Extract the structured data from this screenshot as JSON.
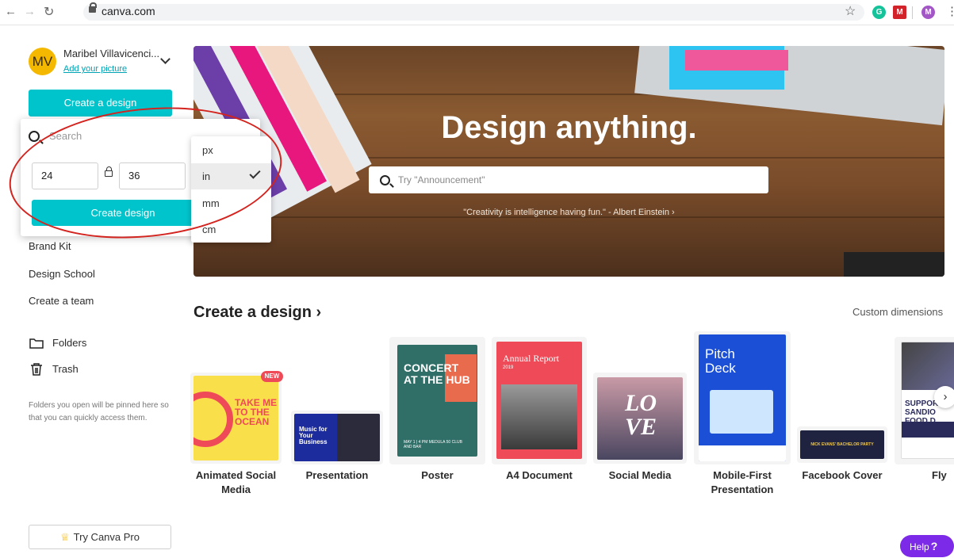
{
  "browser": {
    "url": "canva.com",
    "extensions": [
      {
        "name": "grammarly-icon",
        "letter": "G",
        "color": "#15c39a"
      },
      {
        "name": "mcafee-icon",
        "letter": "M",
        "color": "#d2232a"
      },
      {
        "name": "profile-icon",
        "letter": "M",
        "color": "#8e44ad"
      }
    ]
  },
  "sidebar": {
    "avatar_initials": "MV",
    "user_name": "Maribel Villavicenci...",
    "add_picture": "Add your picture",
    "create_design_button": "Create a design",
    "links": [
      "Brand Kit",
      "Design School",
      "Create a team"
    ],
    "folders": "Folders",
    "trash": "Trash",
    "note": "Folders you open will be pinned here so that you can quickly access them.",
    "try_pro": "Try Canva Pro"
  },
  "popup": {
    "search_placeholder": "Search",
    "width": "24",
    "height": "36",
    "create_button": "Create design",
    "units": [
      "px",
      "in",
      "mm",
      "cm"
    ],
    "selected_unit": "in"
  },
  "hero": {
    "title": "Design anything.",
    "search_placeholder": "Try \"Announcement\"",
    "quote": "\"Creativity is intelligence having fun.\" - Albert Einstein ›"
  },
  "create_section": {
    "title": "Create a design ›",
    "custom_dimensions": "Custom dimensions",
    "new_badge": "NEW",
    "items": [
      {
        "label": "Animated Social Media",
        "thumb_text": "TAKE ME TO THE OCEAN"
      },
      {
        "label": "Presentation",
        "thumb_text": "Music for Your Business"
      },
      {
        "label": "Poster",
        "thumb_text": "CONCERT AT THE HUB",
        "thumb_sub": "MAY 1 | 4 PM MEDULA 50 CLUB AND BAR"
      },
      {
        "label": "A4 Document",
        "thumb_text": "Annual Report",
        "thumb_sub": "2019"
      },
      {
        "label": "Social Media",
        "thumb_text": "LO VE"
      },
      {
        "label": "Mobile-First Presentation",
        "thumb_text": "Pitch Deck"
      },
      {
        "label": "Facebook Cover",
        "thumb_text": "NICK EVANS' BACHELOR PARTY"
      },
      {
        "label": "Fly",
        "thumb_text": "SUPPORT SANDIO FOOD D"
      }
    ]
  },
  "help": {
    "label": "Help",
    "mark": "?"
  }
}
